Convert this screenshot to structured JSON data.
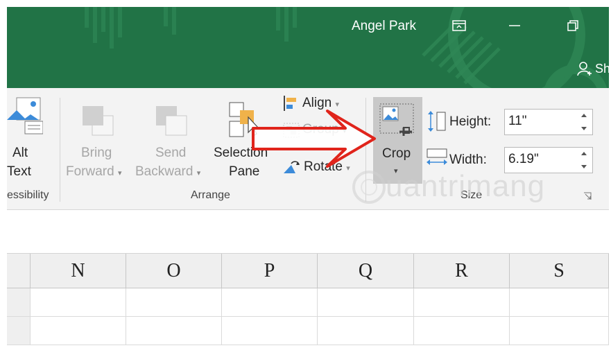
{
  "titlebar": {
    "user_name": "Angel Park",
    "share_label": "Sh",
    "colors": {
      "background": "#217346",
      "text": "#ffffff"
    }
  },
  "window_controls": {
    "ribbon_display_icon": "ribbon-display-options-icon",
    "minimize_icon": "minimize-icon",
    "restore_icon": "restore-down-icon"
  },
  "ribbon": {
    "accessibility": {
      "alt_text_line1": "Alt",
      "alt_text_line2": "Text",
      "group_label": "essibility"
    },
    "arrange": {
      "bring_forward_line1": "Bring",
      "bring_forward_line2": "Forward",
      "send_backward_line1": "Send",
      "send_backward_line2": "Backward",
      "selection_pane_line1": "Selection",
      "selection_pane_line2": "Pane",
      "align": "Align",
      "group": "Group",
      "rotate": "Rotate",
      "group_label": "Arrange"
    },
    "size": {
      "crop": "Crop",
      "height_label": "Height:",
      "height_value": "11\"",
      "width_label": "Width:",
      "width_value": "6.19\"",
      "group_label": "Size"
    }
  },
  "sheet": {
    "columns": [
      "N",
      "O",
      "P",
      "Q",
      "R",
      "S"
    ]
  },
  "watermark": "uantrimang",
  "annotation_color": "#e0241b"
}
